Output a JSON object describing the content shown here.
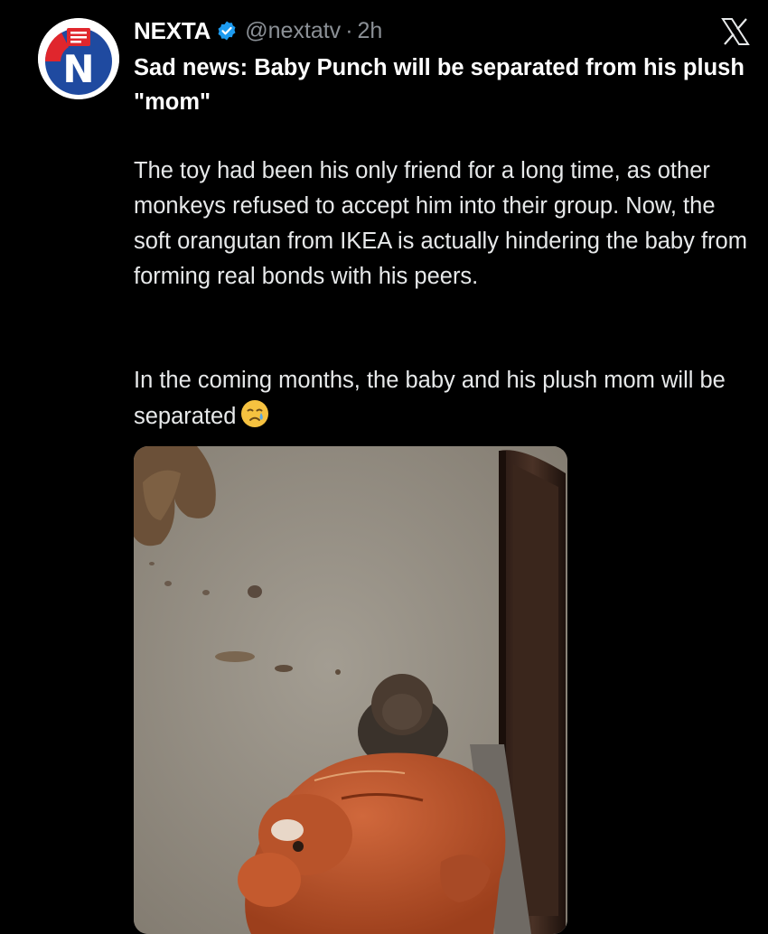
{
  "account": {
    "name": "NEXTA",
    "handle": "@nextatv",
    "separator": "·",
    "time": "2h",
    "avatar_letter": "N",
    "verified_icon": "verified-badge-icon"
  },
  "platform_icon": "x-logo-icon",
  "post": {
    "headline": "Sad news: Baby Punch will be separated from his plush \"mom\"",
    "paragraph_1": "The toy had been his only friend for a long time, as other monkeys refused to accept him into their group. Now, the soft orangutan from IKEA is actually hindering the baby from forming real bonds with his peers.",
    "paragraph_2": "In the coming months, the baby and his plush mom will be separated",
    "emoji": "crying-face-emoji"
  },
  "colors": {
    "background": "#000000",
    "text": "#e7e9ea",
    "secondary": "#8b9096",
    "verified": "#1d9bf0",
    "avatar_red": "#e0262d",
    "avatar_blue": "#1f4aa0"
  }
}
